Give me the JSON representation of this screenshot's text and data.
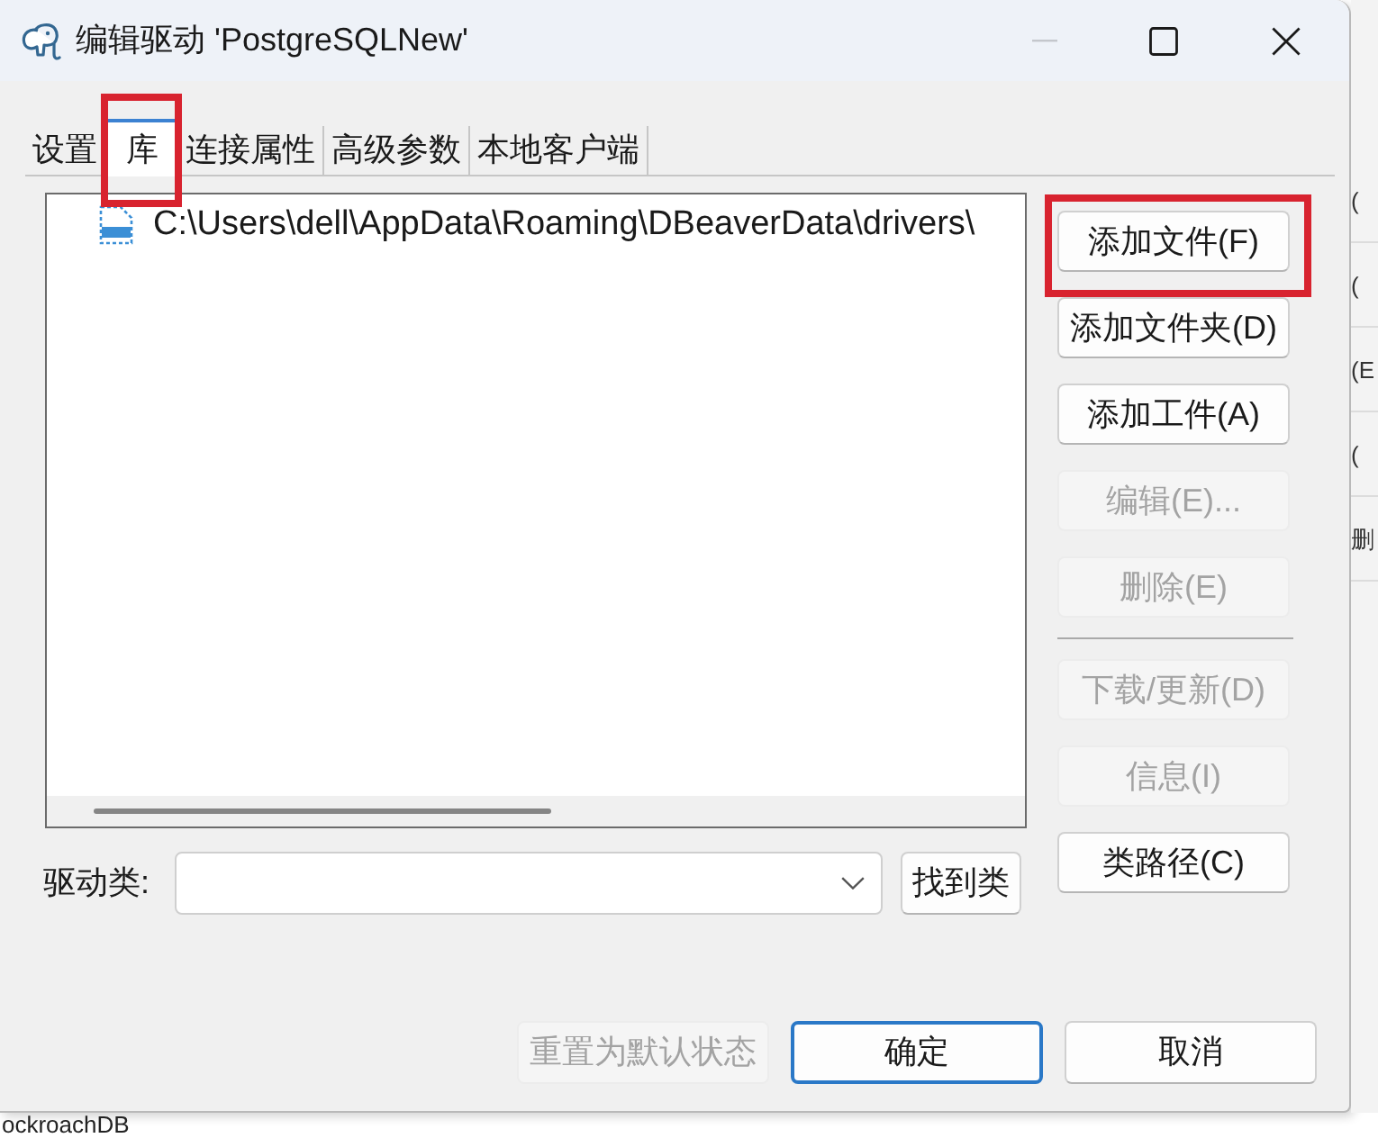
{
  "window": {
    "title": "编辑驱动 'PostgreSQLNew'",
    "minimize_disabled": true
  },
  "tabs": [
    {
      "label": "设置",
      "selected": false,
      "highlighted": false
    },
    {
      "label": "库",
      "selected": true,
      "highlighted": true
    },
    {
      "label": "连接属性",
      "selected": false,
      "highlighted": false
    },
    {
      "label": "高级参数",
      "selected": false,
      "highlighted": false
    },
    {
      "label": "本地客户端",
      "selected": false,
      "highlighted": false
    }
  ],
  "libraries": [
    {
      "path": "C:\\Users\\dell\\AppData\\Roaming\\DBeaverData\\drivers\\"
    }
  ],
  "side_buttons": [
    {
      "kind": "button",
      "label": "添加文件(F)",
      "disabled": false,
      "highlighted": true
    },
    {
      "kind": "button",
      "label": "添加文件夹(D)",
      "disabled": false,
      "highlighted": false
    },
    {
      "kind": "button",
      "label": "添加工件(A)",
      "disabled": false,
      "highlighted": false
    },
    {
      "kind": "button",
      "label": "编辑(E)...",
      "disabled": true,
      "highlighted": false
    },
    {
      "kind": "button",
      "label": "删除(E)",
      "disabled": true,
      "highlighted": false
    },
    {
      "kind": "separator"
    },
    {
      "kind": "button",
      "label": "下载/更新(D)",
      "disabled": true,
      "highlighted": false
    },
    {
      "kind": "button",
      "label": "信息(I)",
      "disabled": true,
      "highlighted": false
    },
    {
      "kind": "button",
      "label": "类路径(C)",
      "disabled": false,
      "highlighted": false
    }
  ],
  "driver_class": {
    "label": "驱动类:",
    "find_button": "找到类"
  },
  "footer_buttons": [
    {
      "label": "重置为默认状态",
      "disabled": true,
      "default": false
    },
    {
      "label": "确定",
      "disabled": false,
      "default": true
    },
    {
      "label": "取消",
      "disabled": false,
      "default": false
    }
  ],
  "background_window": {
    "cells": [
      "(",
      "(",
      "(E",
      "(",
      "删"
    ],
    "bottom_text": "ockroachDB"
  }
}
